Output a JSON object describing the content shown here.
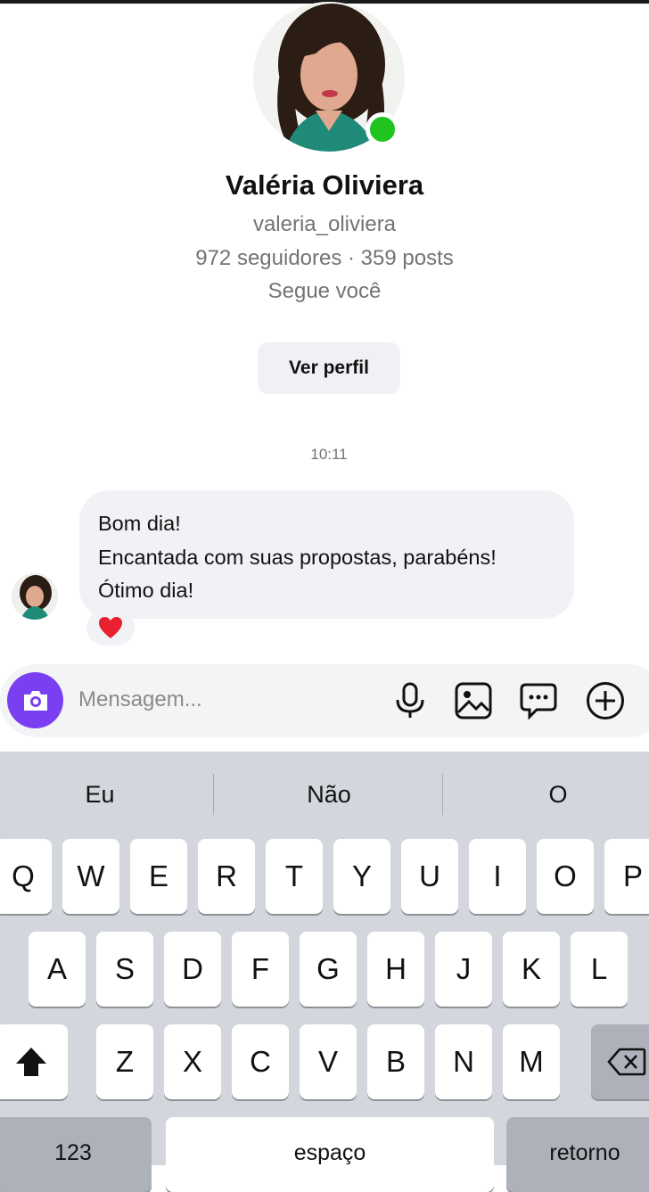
{
  "profile": {
    "name": "Valéria Oliviera",
    "username": "valeria_oliviera",
    "stats": "972 seguidores · 359 posts",
    "follows_you": "Segue você",
    "view_profile_label": "Ver perfil",
    "online": true
  },
  "thread": {
    "timestamp": "10:11",
    "message_lines": [
      "Bom dia!",
      "Encantada com suas propostas, parabéns!",
      "Ótimo dia!"
    ],
    "reaction": "❤️"
  },
  "composer": {
    "placeholder": "Mensagem...",
    "icons": [
      "camera-icon",
      "microphone-icon",
      "image-gallery-icon",
      "sticker-chat-icon",
      "plus-circle-icon"
    ],
    "camera_color": "#7b3ff2"
  },
  "keyboard": {
    "suggestions": [
      "Eu",
      "Não",
      "O"
    ],
    "row1": [
      "Q",
      "W",
      "E",
      "R",
      "T",
      "Y",
      "U",
      "I",
      "O",
      "P"
    ],
    "row2": [
      "A",
      "S",
      "D",
      "F",
      "G",
      "H",
      "J",
      "K",
      "L"
    ],
    "row3": [
      "Z",
      "X",
      "C",
      "V",
      "B",
      "N",
      "M"
    ],
    "numbers_label": "123",
    "space_label": "espaço",
    "return_label": "retorno"
  },
  "colors": {
    "online": "#1fc41f",
    "bubble": "#f1f2f5",
    "keyboard": "#d3d6dc"
  }
}
